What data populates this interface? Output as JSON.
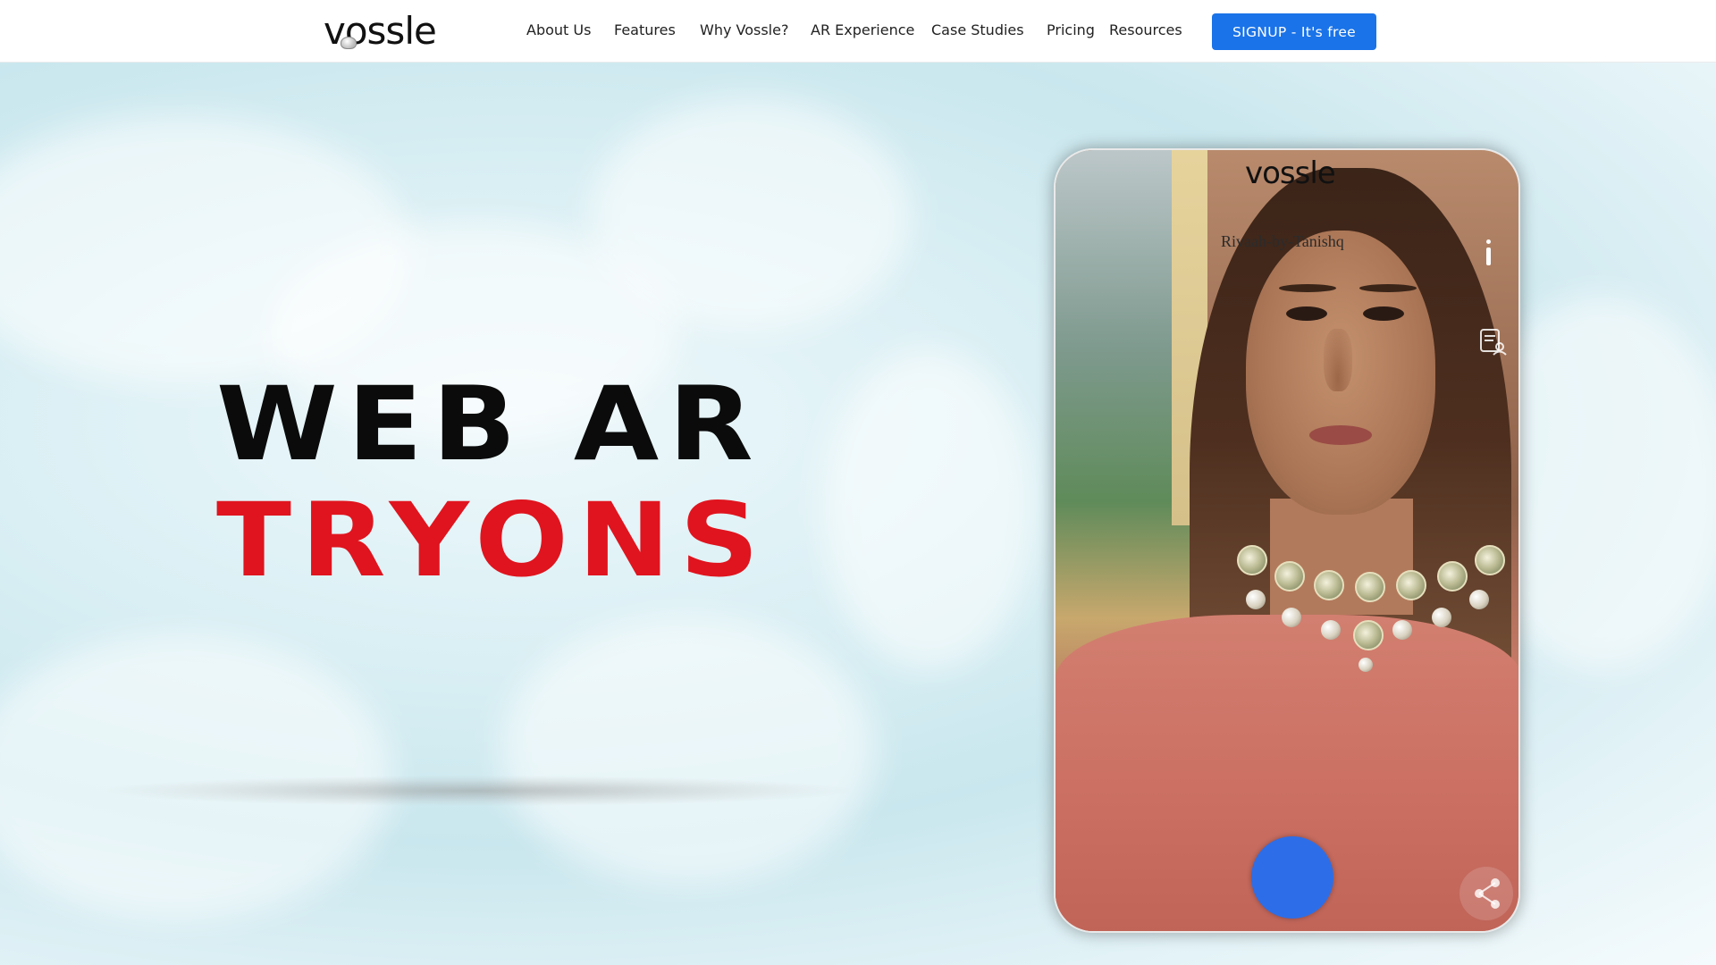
{
  "header": {
    "logo_text": "vossle",
    "nav": [
      {
        "label": "About Us"
      },
      {
        "label": "Features"
      },
      {
        "label": "Why Vossle?"
      },
      {
        "label": "AR Experience"
      },
      {
        "label": "Case Studies"
      },
      {
        "label": "Pricing"
      },
      {
        "label": "Resources"
      }
    ],
    "signup_label": "SIGNUP - It's free"
  },
  "hero": {
    "title_line1": "WEB AR",
    "title_line2": "TRYONS"
  },
  "phone": {
    "logo_text": "vossle",
    "caption": "Rivaah-by-Tanishq",
    "icons": [
      "info-icon",
      "profile-list-icon",
      "share-icon"
    ]
  },
  "colors": {
    "accent": "#1a73e8",
    "title_black": "#0b0b0b",
    "title_red": "#e0141e",
    "capture_blue": "#2d6ee8"
  }
}
